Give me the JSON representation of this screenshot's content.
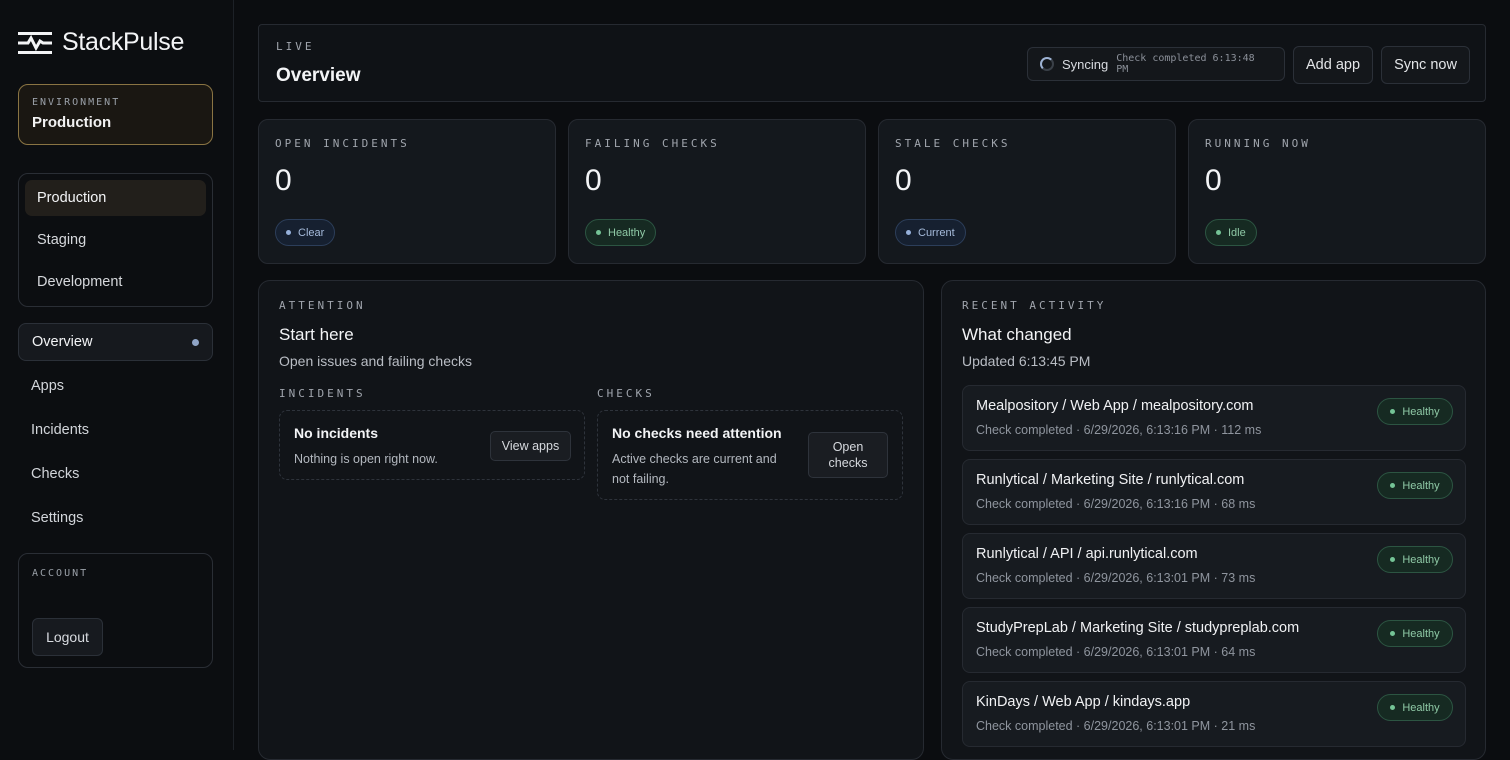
{
  "brand": {
    "name": "StackPulse"
  },
  "environment": {
    "label": "ENVIRONMENT",
    "value": "Production"
  },
  "env_options": [
    "Production",
    "Staging",
    "Development"
  ],
  "nav": [
    "Overview",
    "Apps",
    "Incidents",
    "Checks",
    "Settings"
  ],
  "account": {
    "label": "ACCOUNT",
    "logout": "Logout"
  },
  "header": {
    "kicker": "LIVE",
    "title": "Overview",
    "sync_label": "Syncing",
    "sync_detail": "Check completed 6:13:48 PM",
    "add_app": "Add app",
    "sync_now": "Sync now"
  },
  "stats": [
    {
      "label": "OPEN INCIDENTS",
      "value": "0",
      "badge": "Clear",
      "tone": "blue"
    },
    {
      "label": "FAILING CHECKS",
      "value": "0",
      "badge": "Healthy",
      "tone": "green"
    },
    {
      "label": "STALE CHECKS",
      "value": "0",
      "badge": "Current",
      "tone": "blue"
    },
    {
      "label": "RUNNING NOW",
      "value": "0",
      "badge": "Idle",
      "tone": "green"
    }
  ],
  "attention": {
    "kicker": "ATTENTION",
    "title": "Start here",
    "subtitle": "Open issues and failing checks",
    "incidents": {
      "label": "INCIDENTS",
      "title": "No incidents",
      "desc": "Nothing is open right now.",
      "button": "View apps"
    },
    "checks": {
      "label": "CHECKS",
      "title": "No checks need attention",
      "desc": "Active checks are current and not failing.",
      "button": "Open checks"
    }
  },
  "activity": {
    "kicker": "RECENT ACTIVITY",
    "title": "What changed",
    "updated": "Updated 6:13:45 PM",
    "items": [
      {
        "title": "Mealpository / Web App / mealpository.com",
        "meta": "Check completed · 6/29/2026, 6:13:16 PM · 112 ms",
        "status": "Healthy"
      },
      {
        "title": "Runlytical / Marketing Site / runlytical.com",
        "meta": "Check completed · 6/29/2026, 6:13:16 PM · 68 ms",
        "status": "Healthy"
      },
      {
        "title": "Runlytical / API / api.runlytical.com",
        "meta": "Check completed · 6/29/2026, 6:13:01 PM · 73 ms",
        "status": "Healthy"
      },
      {
        "title": "StudyPrepLab / Marketing Site / studypreplab.com",
        "meta": "Check completed · 6/29/2026, 6:13:01 PM · 64 ms",
        "status": "Healthy"
      },
      {
        "title": "KinDays / Web App / kindays.app",
        "meta": "Check completed · 6/29/2026, 6:13:01 PM · 21 ms",
        "status": "Healthy"
      }
    ]
  },
  "colors": {
    "background": "#0b0d10",
    "accent_env_border": "#8a7443",
    "healthy": "#74c496",
    "info": "#96b0da"
  }
}
